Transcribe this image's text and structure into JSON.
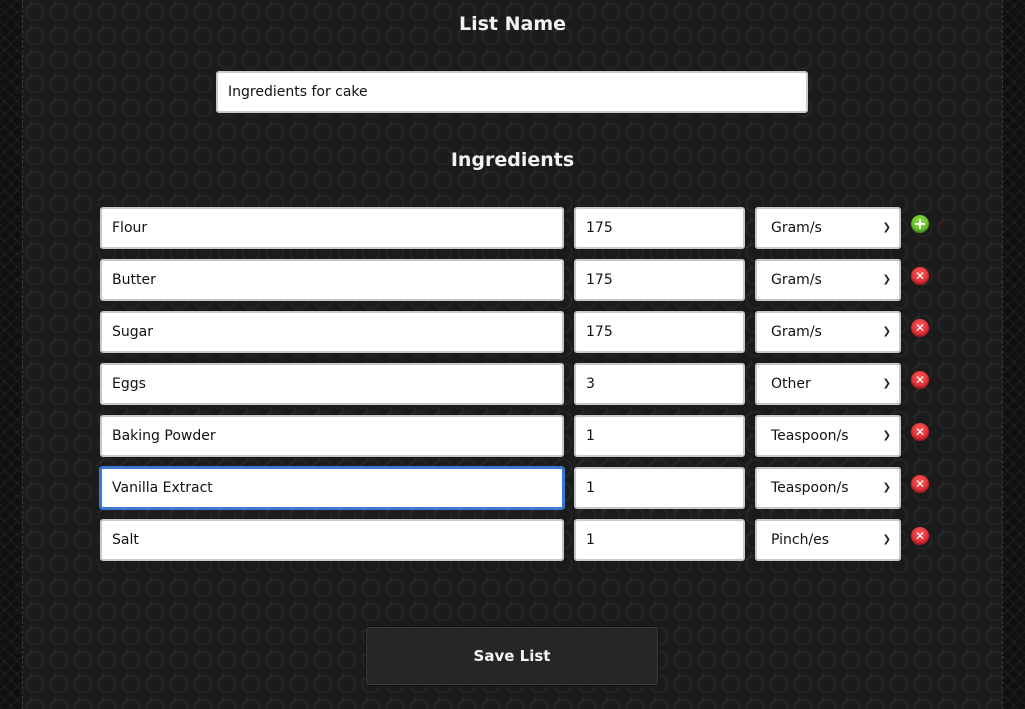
{
  "list_name_heading": "List Name",
  "list_name_value": "Ingredients for cake",
  "ingredients_heading": "Ingredients",
  "ingredients": [
    {
      "name": "Flour",
      "quantity": "175",
      "unit": "Gram/s",
      "action": "add"
    },
    {
      "name": "Butter",
      "quantity": "175",
      "unit": "Gram/s",
      "action": "remove"
    },
    {
      "name": "Sugar",
      "quantity": "175",
      "unit": "Gram/s",
      "action": "remove"
    },
    {
      "name": "Eggs",
      "quantity": "3",
      "unit": "Other",
      "action": "remove"
    },
    {
      "name": "Baking Powder",
      "quantity": "1",
      "unit": "Teaspoon/s",
      "action": "remove"
    },
    {
      "name": "Vanilla Extract",
      "quantity": "1",
      "unit": "Teaspoon/s",
      "action": "remove"
    },
    {
      "name": "Salt",
      "quantity": "1",
      "unit": "Pinch/es",
      "action": "remove"
    }
  ],
  "icons": {
    "add": "plus-circle-icon",
    "remove": "close-circle-icon",
    "dropdown": "chevron-down-icon"
  },
  "colors": {
    "add_button": "#5cbf1e",
    "remove_button": "#e0201f",
    "focus_ring": "#3b78d6"
  },
  "save_button_label": "Save List"
}
